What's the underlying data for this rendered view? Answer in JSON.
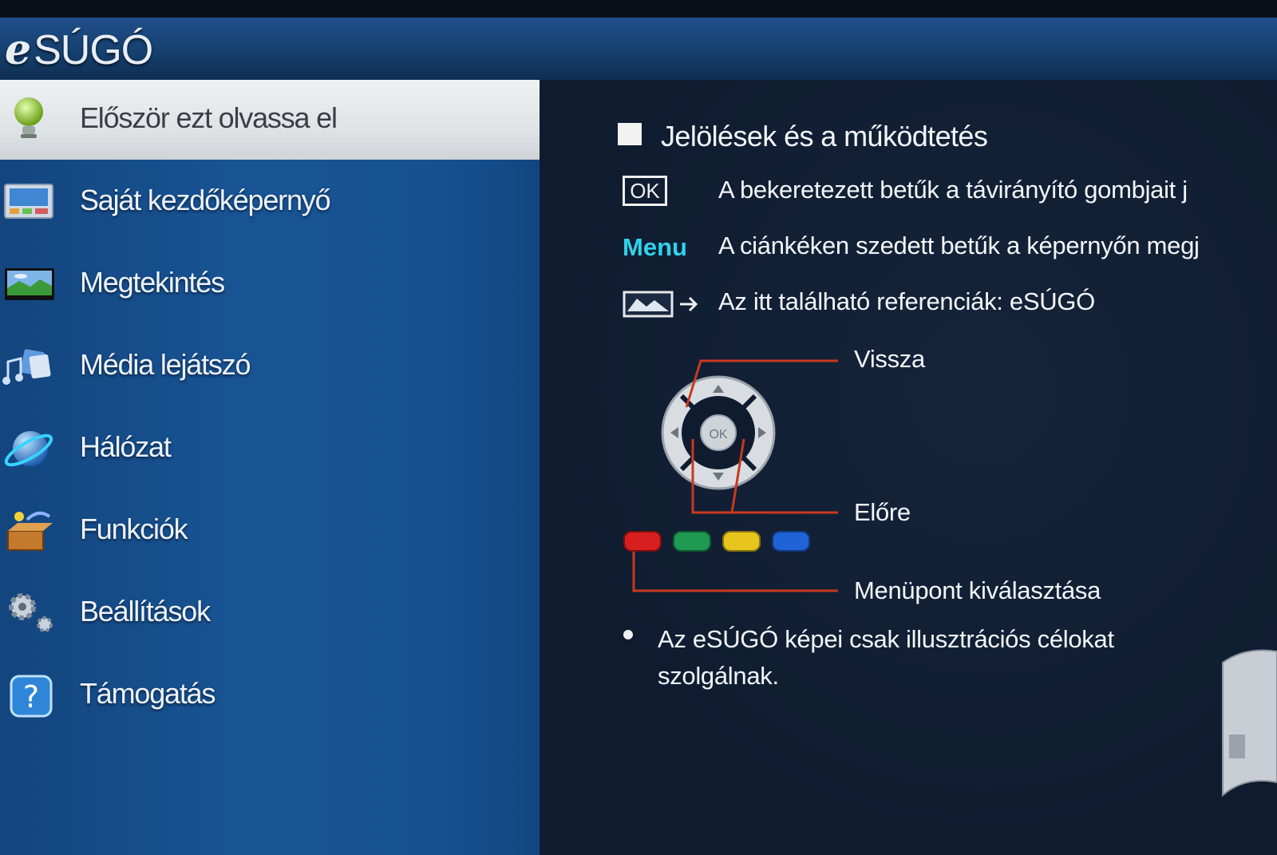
{
  "header": {
    "logo_prefix": "e",
    "logo_text": "SÚGÓ"
  },
  "sidebar": {
    "items": [
      {
        "label": "Először ezt olvassa el",
        "icon": "info-bulb-icon",
        "selected": true
      },
      {
        "label": "Saját kezdőképernyő",
        "icon": "home-screen-icon",
        "selected": false
      },
      {
        "label": "Megtekintés",
        "icon": "tv-landscape-icon",
        "selected": false
      },
      {
        "label": "Média lejátszó",
        "icon": "media-player-icon",
        "selected": false
      },
      {
        "label": "Hálózat",
        "icon": "network-globe-icon",
        "selected": false
      },
      {
        "label": "Funkciók",
        "icon": "functions-box-icon",
        "selected": false
      },
      {
        "label": "Beállítások",
        "icon": "settings-gear-icon",
        "selected": false
      },
      {
        "label": "Támogatás",
        "icon": "support-question-icon",
        "selected": false
      }
    ]
  },
  "content": {
    "section_title": "Jelölések és a működtetés",
    "rows": [
      {
        "key": "OK",
        "text": "A bekeretezett betűk a távirányító gombjait j"
      },
      {
        "key": "Menu",
        "text": "A ciánkéken szedett betűk a képernyőn megj"
      },
      {
        "key_icon": "esugo-reference-icon",
        "text": "Az itt található referenciák: eSÚGÓ"
      }
    ],
    "diagram": {
      "center_label": "OK",
      "labels": {
        "back": "Vissza",
        "forward": "Előre",
        "select": "Menüpont kiválasztása"
      },
      "color_buttons": [
        "#d71f1f",
        "#1f9a52",
        "#e8c51c",
        "#1f63d6"
      ]
    },
    "note": "Az eSÚGÓ képei csak illusztrációs célokat szolgálnak."
  },
  "colors": {
    "accent_cyan": "#2fd3ec",
    "sidebar_blue": "#185494",
    "line_red": "#c8391e"
  }
}
